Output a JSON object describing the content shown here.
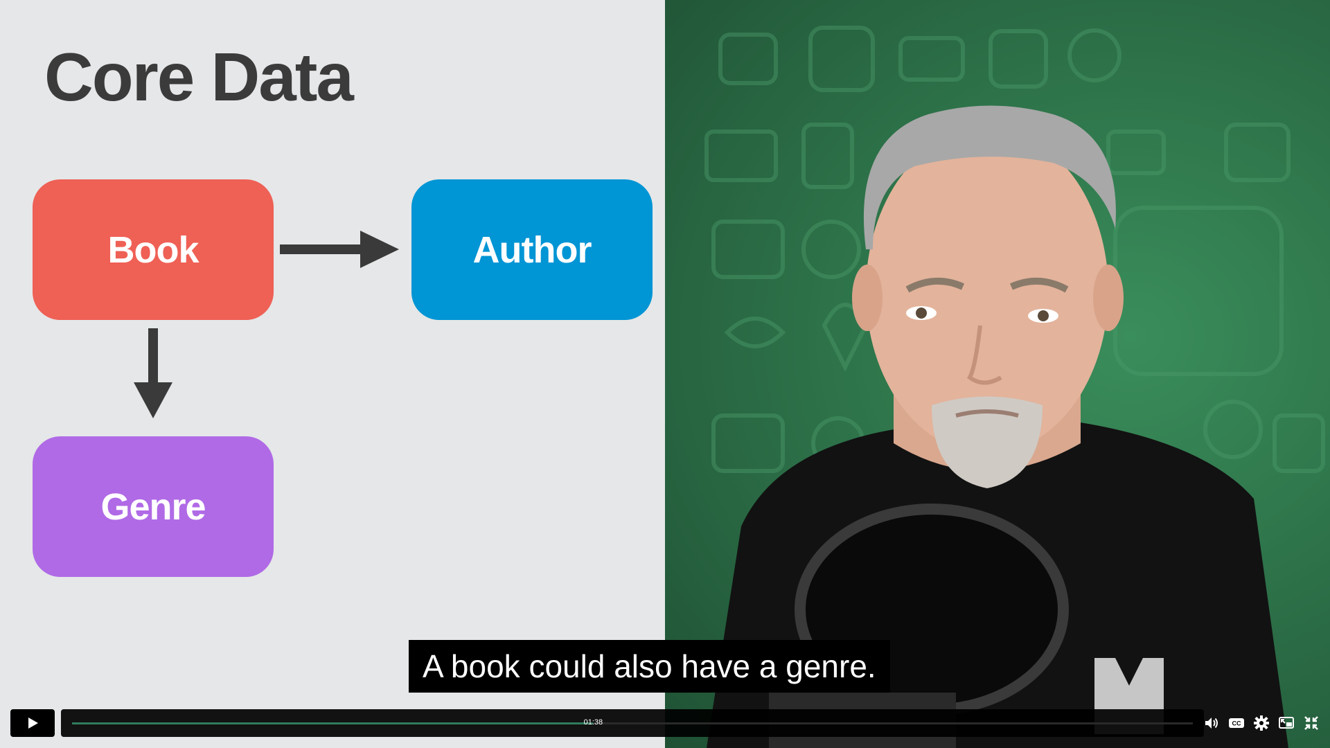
{
  "slide": {
    "title": "Core Data",
    "nodes": {
      "book": {
        "label": "Book",
        "color": "#ef6055"
      },
      "author": {
        "label": "Author",
        "color": "#0095d5"
      },
      "genre": {
        "label": "Genre",
        "color": "#b06ae6"
      }
    }
  },
  "caption": {
    "text": "A book could also have a genre."
  },
  "player": {
    "time_tooltip": "01:38",
    "progress": 0.465,
    "icons": [
      "play-icon",
      "volume-icon",
      "closed-captions-icon",
      "settings-gear-icon",
      "picture-in-picture-icon",
      "exit-fullscreen-icon"
    ]
  },
  "colors": {
    "progress": "#2f7d5e",
    "presenter_bg": "#2b6d46"
  }
}
